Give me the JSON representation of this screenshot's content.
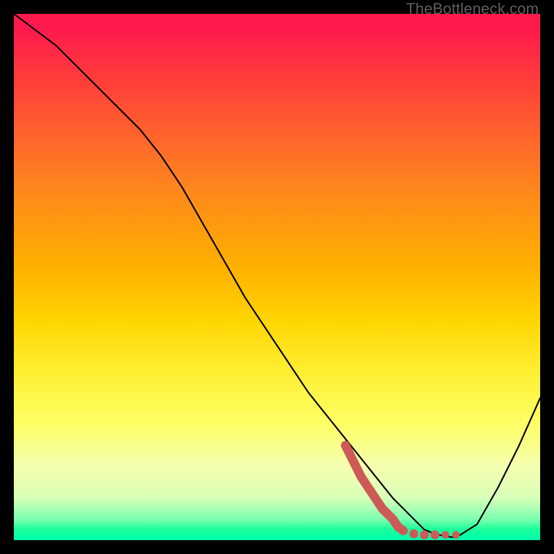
{
  "watermark": "TheBottleneck.com",
  "chart_data": {
    "type": "line",
    "title": "",
    "xlabel": "",
    "ylabel": "",
    "xlim": [
      0,
      100
    ],
    "ylim": [
      0,
      100
    ],
    "series": [
      {
        "name": "bottleneck-curve",
        "color": "#000000",
        "x": [
          0,
          8,
          12,
          16,
          20,
          24,
          28,
          32,
          36,
          40,
          44,
          48,
          52,
          56,
          60,
          64,
          68,
          72,
          74,
          76,
          78,
          80,
          82,
          84,
          88,
          92,
          96,
          100
        ],
        "values": [
          100,
          94,
          90,
          86,
          82,
          78,
          73,
          67,
          60,
          53,
          46,
          40,
          34,
          28,
          23,
          18,
          13,
          8,
          6,
          4,
          2,
          1.2,
          0.7,
          0.5,
          3,
          10,
          18,
          27
        ]
      }
    ],
    "markers": {
      "name": "recommended-range",
      "color": "#cc5b57",
      "points": [
        {
          "x": 63,
          "y": 18
        },
        {
          "x": 64,
          "y": 16
        },
        {
          "x": 66,
          "y": 12
        },
        {
          "x": 68,
          "y": 9
        },
        {
          "x": 70,
          "y": 6
        },
        {
          "x": 72,
          "y": 4
        },
        {
          "x": 73,
          "y": 2.5
        },
        {
          "x": 74,
          "y": 1.8
        },
        {
          "x": 76,
          "y": 1.2
        },
        {
          "x": 78,
          "y": 1.0
        },
        {
          "x": 80,
          "y": 1.0
        },
        {
          "x": 82,
          "y": 1.0
        },
        {
          "x": 84,
          "y": 1.0
        }
      ]
    }
  }
}
